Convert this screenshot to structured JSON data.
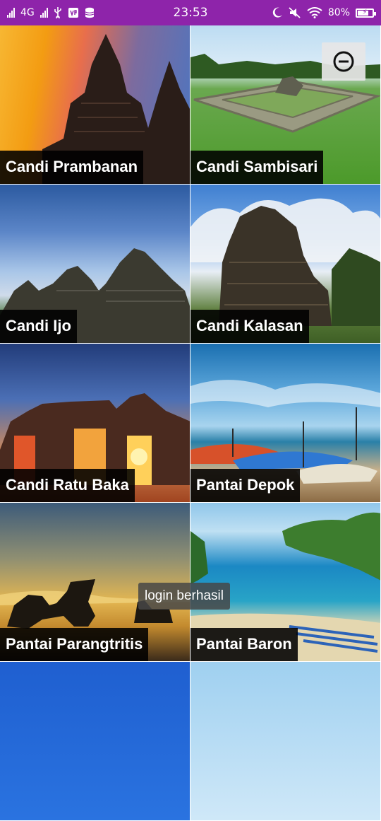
{
  "status_bar": {
    "network_label": "4G",
    "time": "23:53",
    "battery_percent": "80%",
    "icons": [
      "signal-icon",
      "usb-icon",
      "vpn-icon",
      "storage-icon",
      "moon-icon",
      "mute-icon",
      "wifi-icon",
      "battery-icon"
    ]
  },
  "tiles": [
    {
      "label": "Candi Prambanan"
    },
    {
      "label": "Candi Sambisari"
    },
    {
      "label": "Candi Ijo"
    },
    {
      "label": "Candi Kalasan"
    },
    {
      "label": "Candi Ratu Baka"
    },
    {
      "label": "Pantai Depok"
    },
    {
      "label": "Pantai Parangtritis"
    },
    {
      "label": "Pantai Baron"
    }
  ],
  "zoom_out": {
    "icon": "zoom-out-icon"
  },
  "toast": {
    "text": "login berhasil"
  },
  "colors": {
    "status_bar": "#8e24aa",
    "label_bg": "#000000",
    "label_text": "#ffffff"
  }
}
